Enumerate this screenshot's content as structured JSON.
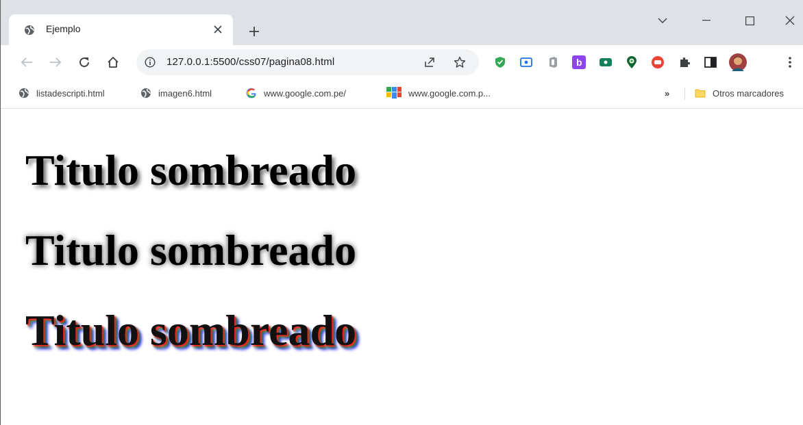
{
  "tab": {
    "title": "Ejemplo"
  },
  "address": {
    "url": "127.0.0.1:5500/css07/pagina08.html"
  },
  "bookmarks": {
    "items": [
      {
        "label": "listadescripti.html"
      },
      {
        "label": "imagen6.html"
      },
      {
        "label": "www.google.com.pe/"
      },
      {
        "label": "www.google.com.p..."
      }
    ],
    "overflow": "»",
    "other": "Otros marcadores"
  },
  "page": {
    "headings": [
      "Titulo sombreado",
      "Titulo sombreado",
      "Titulo sombreado"
    ]
  },
  "colors": {
    "tabstrip": "#dee1e6",
    "omnibox": "#f1f3f4",
    "shadow_red": "#ff1a1a",
    "shadow_green": "#2b8a2b",
    "shadow_blue": "#2020ff"
  },
  "icons": {
    "tab": "globe-icon",
    "extensions": [
      "shield-extension-icon",
      "screen-extension-icon",
      "office-extension-icon",
      "b-extension-icon",
      "green-extension-icon",
      "location-extension-icon",
      "red-extension-icon",
      "puzzle-icon",
      "side-panel-icon",
      "avatar",
      "menu-icon"
    ]
  }
}
